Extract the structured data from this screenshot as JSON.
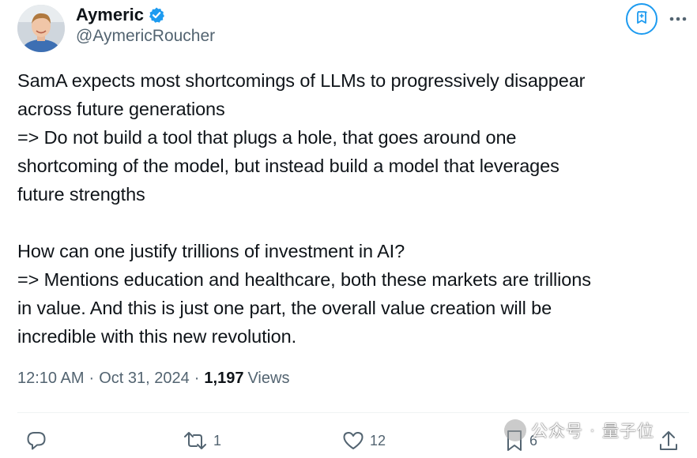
{
  "author": {
    "display_name": "Aymeric",
    "handle": "@AymericRoucher",
    "verified": true,
    "verified_color": "#1d9bf0"
  },
  "tweet": {
    "text": "SamA expects most shortcomings of LLMs to progressively disappear\nacross future generations\n=> Do not build a tool that plugs a hole, that goes around one\nshortcoming of the model, but instead build a model that leverages\nfuture strengths\n\nHow can one justify trillions of investment in AI?\n=> Mentions education and healthcare, both these markets are trillions\nin value. And this is just one part, the overall value creation will be\nincredible with this new revolution."
  },
  "meta": {
    "time": "12:10 AM",
    "date": "Oct 31, 2024",
    "separator": "·",
    "views_count": "1,197",
    "views_label": "Views"
  },
  "actions": {
    "reply_icon": "reply-icon",
    "retweet_count": "1",
    "like_count": "12",
    "bookmark_count": "6",
    "share_icon": "share-icon"
  },
  "watermark": {
    "text_left": "公众号",
    "dot": "·",
    "text_right": "量子位"
  },
  "colors": {
    "text_primary": "#0f1419",
    "text_secondary": "#536471",
    "accent": "#1d9bf0",
    "divider": "#eff3f4"
  }
}
